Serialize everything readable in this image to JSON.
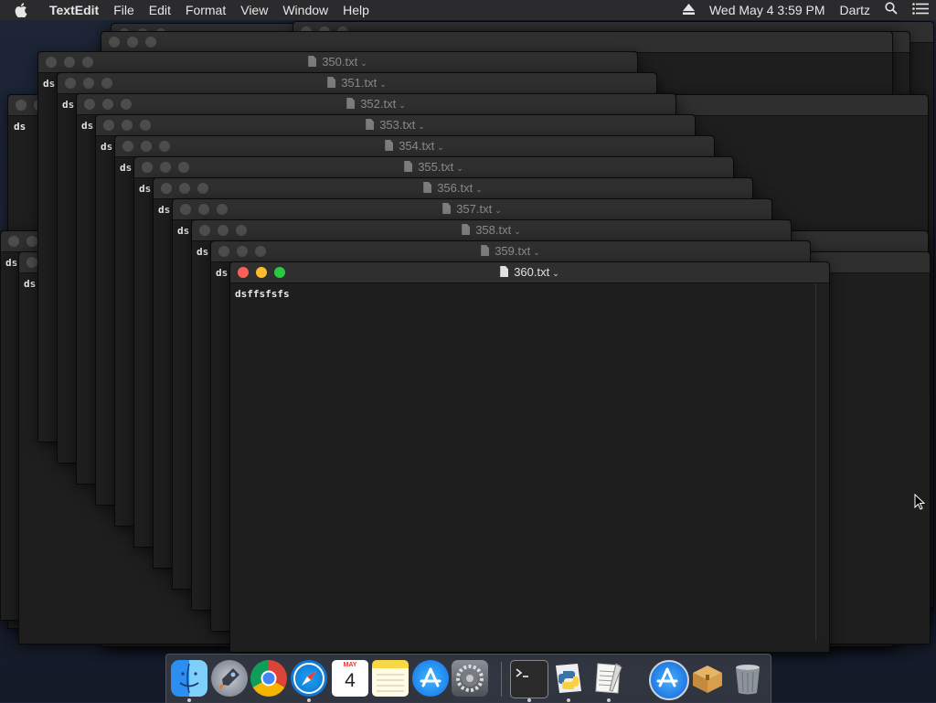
{
  "menubar": {
    "apple": "apple-icon",
    "app_name": "TextEdit",
    "menus": [
      "File",
      "Edit",
      "Format",
      "View",
      "Window",
      "Help"
    ],
    "datetime": "Wed May 4  3:59 PM",
    "user": "Dartz"
  },
  "windows": [
    {
      "title": "350.txt",
      "content": "ds"
    },
    {
      "title": "351.txt",
      "content": "ds"
    },
    {
      "title": "352.txt",
      "content": "ds"
    },
    {
      "title": "353.txt",
      "content": "ds"
    },
    {
      "title": "354.txt",
      "content": "ds"
    },
    {
      "title": "355.txt",
      "content": "ds"
    },
    {
      "title": "356.txt",
      "content": "ds"
    },
    {
      "title": "357.txt",
      "content": "ds"
    },
    {
      "title": "358.txt",
      "content": "ds"
    },
    {
      "title": "359.txt",
      "content": "ds"
    },
    {
      "title": "360.txt",
      "content": "dsffsfsfs"
    }
  ],
  "dock": {
    "calendar_month": "MAY",
    "calendar_day": "4",
    "apps": [
      "finder-icon",
      "launchpad-icon",
      "chrome-icon",
      "safari-icon",
      "calendar-icon",
      "notes-icon",
      "app-store-icon",
      "system-preferences-icon",
      "terminal-icon",
      "python-launcher-icon",
      "textedit-icon",
      "xcode-app-store-icon",
      "archive-utility-icon",
      "trash-icon"
    ]
  },
  "colors": {
    "close": "#fc5f57",
    "minimize": "#fdbc2e",
    "zoom": "#29c940",
    "desktop": "#1b2233"
  }
}
